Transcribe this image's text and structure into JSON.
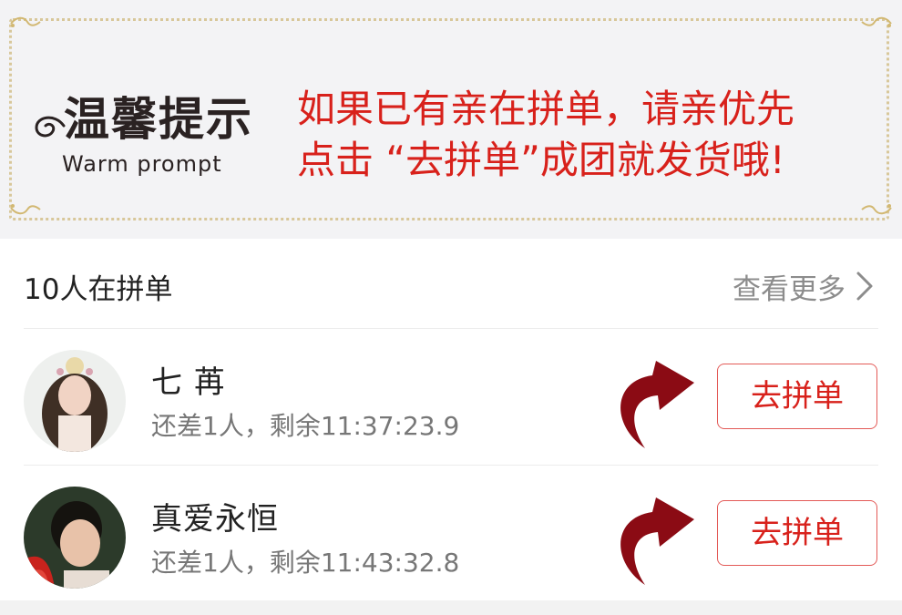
{
  "banner": {
    "logo_title": "温馨提示",
    "logo_subtitle": "Warm prompt",
    "notice_line1": "如果已有亲在拼单，请亲优先",
    "notice_line2": "点击 “去拼单”成团就发货哦!"
  },
  "group_section": {
    "title": "10人在拼单",
    "more_label": "查看更多",
    "groups": [
      {
        "name": "七  苒",
        "status": "还差1人，剩余11:37:23.9",
        "button": "去拼单"
      },
      {
        "name": "真爱永恒",
        "status": "还差1人，剩余11:43:32.8",
        "button": "去拼单"
      }
    ]
  },
  "colors": {
    "accent": "#d8211b",
    "arrow": "#8b0b14",
    "gold_border": "#d8c79a"
  },
  "icons": [
    "chevron-right-icon",
    "curved-arrow-icon",
    "ornament-corner-icon"
  ]
}
